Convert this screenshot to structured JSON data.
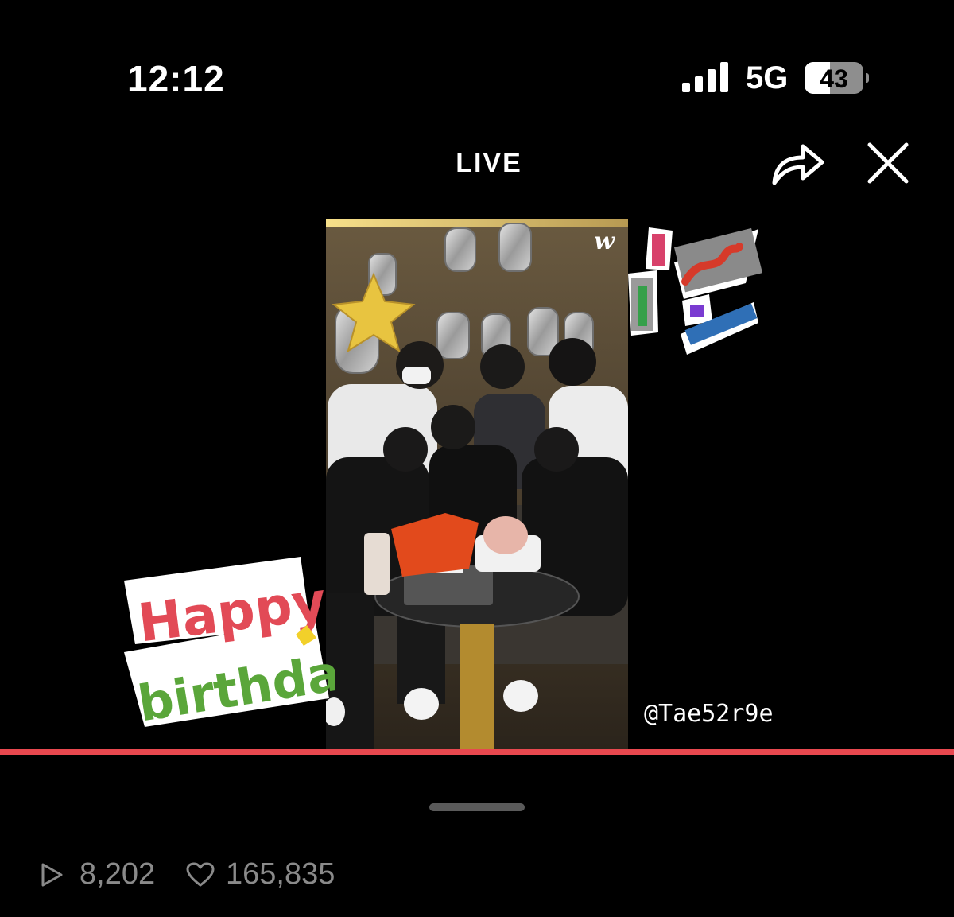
{
  "status_bar": {
    "time": "12:12",
    "network": "5G",
    "battery_level": 43,
    "battery_text": "43",
    "signal_icon": "signal-bars-icon"
  },
  "header": {
    "title": "LIVE",
    "share_icon": "share-arrow-icon",
    "close_icon": "close-x-icon"
  },
  "video": {
    "watermark_handle": "@Tae52r9e",
    "brand_mark": "w",
    "progress": 1.0,
    "progress_color": "#e8484f"
  },
  "stickers": {
    "birthday_line1": "Happy",
    "birthday_line2": "birthday"
  },
  "footer": {
    "views": "8,202",
    "likes": "165,835",
    "views_icon": "play-icon",
    "likes_icon": "heart-icon"
  }
}
